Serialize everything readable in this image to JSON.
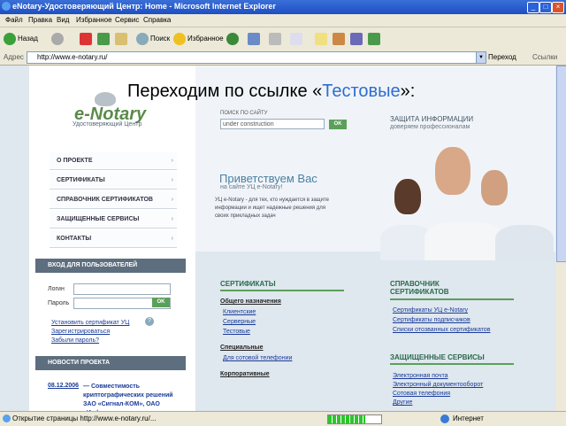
{
  "window": {
    "title": "eNotary-Удостоверяющий Центр: Home - Microsoft Internet Explorer"
  },
  "menubar": [
    "Файл",
    "Правка",
    "Вид",
    "Избранное",
    "Сервис",
    "Справка"
  ],
  "toolbar": {
    "back": "Назад",
    "search": "Поиск",
    "favorites": "Избранное"
  },
  "address": {
    "label": "Адрес",
    "url": "http://www.e-notary.ru/",
    "go": "Переход",
    "links": "Ссылки"
  },
  "caption": {
    "prefix": "Переходим по ссылке «",
    "highlight": "Тестовые",
    "suffix": "»:"
  },
  "site": {
    "logo": "e-Notary",
    "logo_sub": "Удостоверяющий Центр",
    "search_label": "ПОИСК ПО САЙТУ",
    "search_value": "under construction",
    "ok": "OK",
    "protect_title": "ЗАЩИТА ИНФОРМАЦИИ",
    "protect_sub": "доверяем профессионалам",
    "nav": [
      "О ПРОЕКТЕ",
      "СЕРТИФИКАТЫ",
      "СПРАВОЧНИК СЕРТИФИКАТОВ",
      "ЗАЩИЩЕННЫЕ СЕРВИСЫ",
      "КОНТАКТЫ"
    ],
    "welcome_title": "Приветствуем Вас",
    "welcome_sub": "на сайте УЦ e-Notary!",
    "welcome_desc": "УЦ e-Notary - для тех, кто нуждается в защите информации и ищет надежные решения для своих прикладных задач",
    "login": {
      "header": "ВХОД ДЛЯ ПОЛЬЗОВАТЕЛЕЙ",
      "login_label": "Логин",
      "password_label": "Пароль",
      "links": [
        "Установить сертификат УЦ",
        "Зарегистрироваться",
        "Забыли пароль?"
      ]
    },
    "news": {
      "header": "НОВОСТИ ПРОЕКТА",
      "date": "08.12.2006",
      "text": "— Совместимость криптографических решений ЗАО «Сигнал-КОМ», ОАО «Инфотекс» и"
    },
    "certs": {
      "title": "СЕРТИФИКАТЫ",
      "general": "Общего назначения",
      "general_links": [
        "Клиентские",
        "Серверные",
        "Тестовые"
      ],
      "special": "Специальные",
      "special_links": [
        "Для сотовой телефонии"
      ],
      "corporate": "Корпоративные"
    },
    "directory": {
      "title": [
        "СПРАВОЧНИК",
        "СЕРТИФИКАТОВ"
      ],
      "links": [
        "Сертификаты УЦ e-Notary",
        "Сертификаты подписчиков",
        "Списки отозванных сертификатов"
      ]
    },
    "services": {
      "title": "ЗАЩИЩЕННЫЕ СЕРВИСЫ",
      "links": [
        "Электронная почта",
        "Электронный документооборот",
        "Сотовая телефония",
        "Другие"
      ]
    }
  },
  "status": {
    "text": "Открытие страницы http://www.e-notary.ru/...",
    "zone": "Интернет",
    "progress": 0.7
  },
  "colors": {
    "accent": "#2f6ccf",
    "green": "#5aa05a",
    "nav_header": "#5d6e7e"
  }
}
